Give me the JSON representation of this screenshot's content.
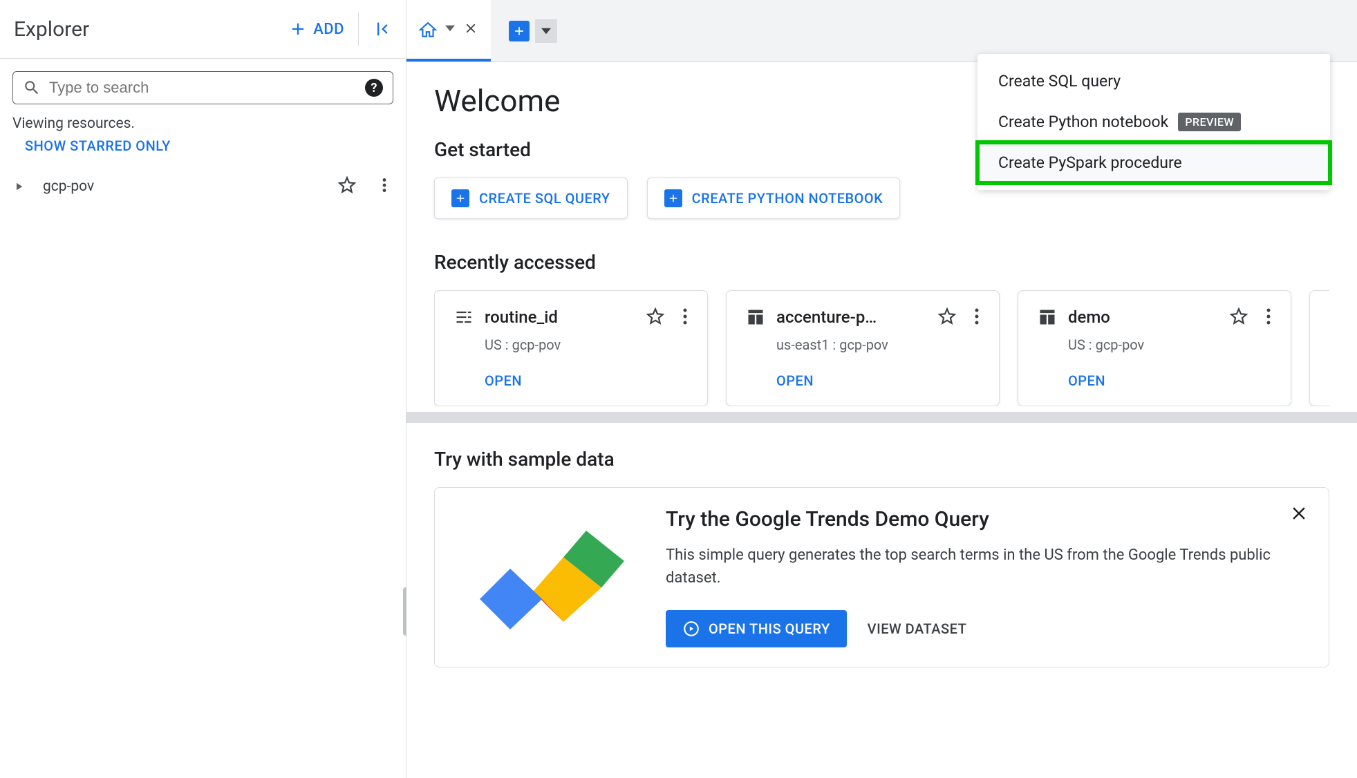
{
  "sidebar": {
    "title": "Explorer",
    "add_label": "ADD",
    "search_placeholder": "Type to search",
    "viewing_text": "Viewing resources.",
    "show_starred_label": "SHOW STARRED ONLY",
    "tree": {
      "items": [
        {
          "label": "gcp-pov"
        }
      ]
    }
  },
  "dropdown": {
    "items": [
      {
        "label": "Create SQL query",
        "badge": null,
        "highlighted": false
      },
      {
        "label": "Create Python notebook",
        "badge": "PREVIEW",
        "highlighted": false
      },
      {
        "label": "Create PySpark procedure",
        "badge": null,
        "highlighted": true
      }
    ]
  },
  "main": {
    "welcome_title": "Welcome",
    "get_started_title": "Get started",
    "action_buttons": [
      {
        "label": "CREATE SQL QUERY"
      },
      {
        "label": "CREATE PYTHON NOTEBOOK"
      }
    ],
    "recently_title": "Recently accessed",
    "recent_cards": [
      {
        "icon": "routine",
        "title": "routine_id",
        "sub": "US : gcp-pov",
        "open": "OPEN"
      },
      {
        "icon": "table",
        "title": "accenture-p…",
        "sub": "us-east1 : gcp-pov",
        "open": "OPEN"
      },
      {
        "icon": "table",
        "title": "demo",
        "sub": "US : gcp-pov",
        "open": "OPEN"
      }
    ],
    "sample_title": "Try with sample data",
    "sample": {
      "title": "Try the Google Trends Demo Query",
      "desc": "This simple query generates the top search terms in the US from the Google Trends public dataset.",
      "open_label": "OPEN THIS QUERY",
      "view_label": "VIEW DATASET"
    }
  }
}
